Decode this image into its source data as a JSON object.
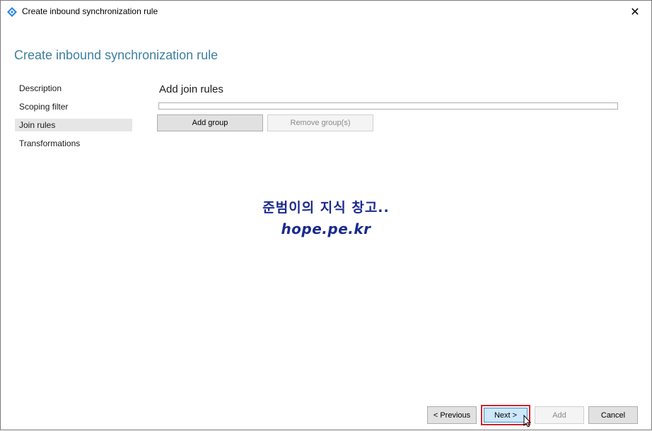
{
  "window": {
    "title": "Create inbound synchronization rule",
    "close_glyph": "✕",
    "app_icon": "diamond-sync-icon",
    "accent_color": "#3f7fa0"
  },
  "page": {
    "heading": "Create inbound synchronization rule"
  },
  "nav": {
    "items": [
      {
        "label": "Description",
        "active": false
      },
      {
        "label": "Scoping filter",
        "active": false
      },
      {
        "label": "Join rules",
        "active": true
      },
      {
        "label": "Transformations",
        "active": false
      }
    ]
  },
  "join_rules": {
    "title": "Add join rules",
    "add_group_label": "Add group",
    "remove_group_label": "Remove group(s)"
  },
  "watermark": {
    "line1": "준범이의 지식 창고..",
    "line2": "hope.pe.kr"
  },
  "footer": {
    "previous_label": "< Previous",
    "next_label": "Next >",
    "add_label": "Add",
    "cancel_label": "Cancel",
    "highlight_color": "#d0222e"
  }
}
